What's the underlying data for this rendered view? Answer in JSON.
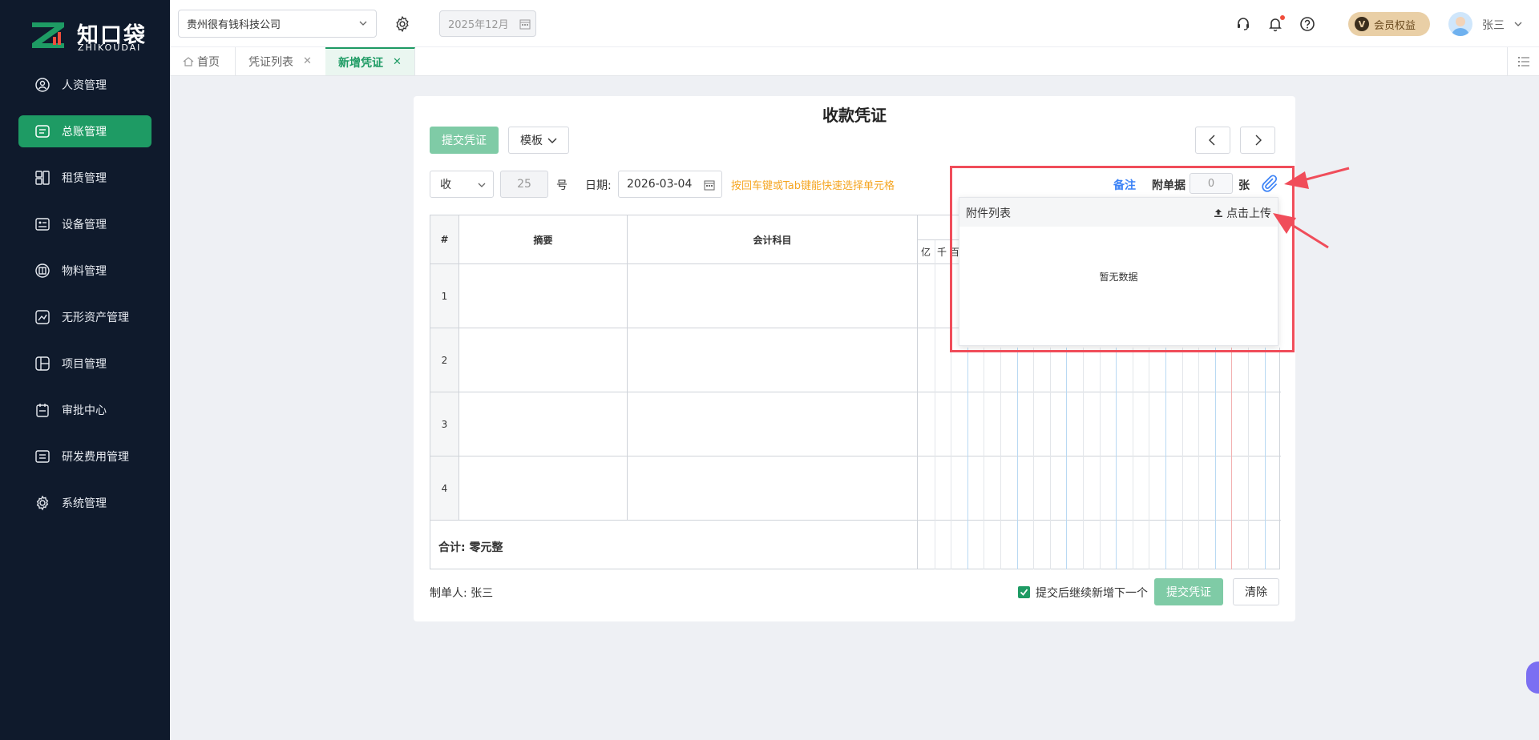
{
  "brand": {
    "name_cn": "知口袋",
    "name_en": "ZHIKOUDAI"
  },
  "sidebar": {
    "items": [
      {
        "label": "人资管理",
        "icon": "user-circle-icon",
        "active": false
      },
      {
        "label": "总账管理",
        "icon": "ledger-icon",
        "active": true
      },
      {
        "label": "租赁管理",
        "icon": "lease-icon",
        "active": false
      },
      {
        "label": "设备管理",
        "icon": "device-icon",
        "active": false
      },
      {
        "label": "物料管理",
        "icon": "box-icon",
        "active": false
      },
      {
        "label": "无形资产管理",
        "icon": "asset-icon",
        "active": false
      },
      {
        "label": "项目管理",
        "icon": "project-icon",
        "active": false
      },
      {
        "label": "审批中心",
        "icon": "approval-icon",
        "active": false
      },
      {
        "label": "研发费用管理",
        "icon": "rd-icon",
        "active": false
      },
      {
        "label": "系统管理",
        "icon": "gear-icon",
        "active": false
      }
    ]
  },
  "header": {
    "company": "贵州很有钱科技公司",
    "period": "2025年12月",
    "vip_label": "会员权益",
    "vip_badge": "V",
    "user_name": "张三"
  },
  "tabs": [
    {
      "label": "首页",
      "closable": false,
      "active": false
    },
    {
      "label": "凭证列表",
      "closable": true,
      "active": false
    },
    {
      "label": "新增凭证",
      "closable": true,
      "active": true
    }
  ],
  "voucher": {
    "title": "收款凭证",
    "submit_label": "提交凭证",
    "template_label": "模板",
    "type_value": "收",
    "number_value": "25",
    "number_suffix": "号",
    "date_label": "日期:",
    "date_value": "2026-03-04",
    "hint": "按回车键或Tab键能快速选择单元格",
    "columns": {
      "index": "#",
      "summary": "摘要",
      "account": "会计科目",
      "digits": [
        "亿",
        "千",
        "百"
      ]
    },
    "rows": [
      "1",
      "2",
      "3",
      "4"
    ],
    "total_label": "合计:",
    "total_value": "零元整",
    "maker_label": "制单人:",
    "maker_name": "张三",
    "continue_label": "提交后继续新增下一个",
    "continue_checked": true,
    "clear_label": "清除"
  },
  "attachments": {
    "note_label": "备注",
    "attach_label": "附单据",
    "count": "0",
    "unit": "张",
    "list_title": "附件列表",
    "upload_label": "点击上传",
    "empty_text": "暂无数据"
  },
  "colors": {
    "primary": "#1e9b64",
    "sidebar_bg": "#0f1a2c",
    "highlight": "#f04d5a",
    "link": "#3b82f6",
    "hint": "#f5a623"
  }
}
